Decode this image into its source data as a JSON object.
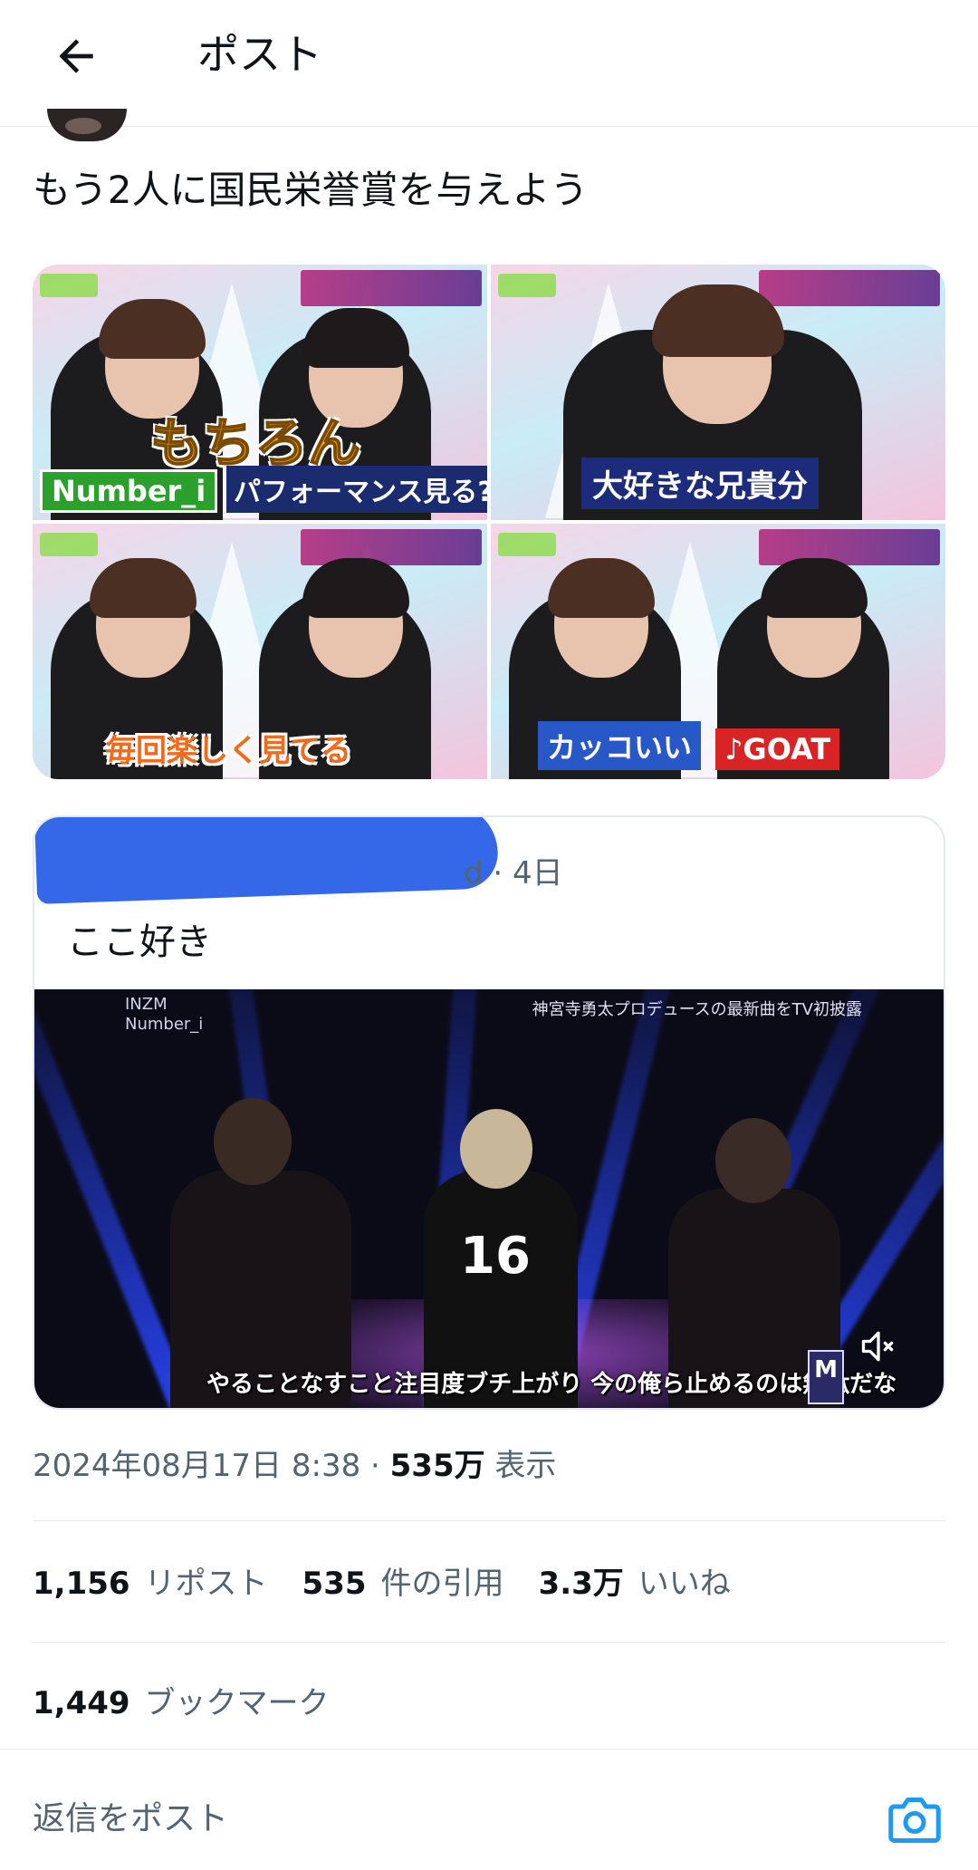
{
  "header": {
    "title": "ポスト",
    "back_icon": "arrow-left-icon"
  },
  "tweet": {
    "text": "もう2人に国民栄誉賞を与えよう",
    "media": [
      {
        "captions": [
          "もちろん",
          "Number_i",
          "パフォーマンス見る?"
        ]
      },
      {
        "captions": [
          "大好きな兄貴分"
        ]
      },
      {
        "captions": [
          "毎回楽しく見てる"
        ]
      },
      {
        "captions": [
          "カッコいい",
          "♪GOAT"
        ]
      }
    ]
  },
  "quote": {
    "time": "d · 4日",
    "text": "ここ好き",
    "video": {
      "label_top_left": "INZM\nNumber_i",
      "label_top_right": "神宮寺勇太プロデュースの最新曲をTV初披露",
      "subtitle": "やることなすこと注目度ブチ上がり 今の俺ら止めるのは無駄だな",
      "badge": "M",
      "shirt_number": "16"
    }
  },
  "meta": {
    "date": "2024年08月17日 8:38 · ",
    "views": "535万",
    "views_label": " 表示"
  },
  "stats": {
    "reposts": "1,156",
    "reposts_label": "リポスト",
    "quotes": "535",
    "quotes_label": "件の引用",
    "likes": "3.3万",
    "likes_label": "いいね",
    "bookmarks": "1,449",
    "bookmarks_label": "ブックマーク"
  },
  "reply": {
    "placeholder": "返信をポスト",
    "camera_icon": "camera-icon"
  },
  "colors": {
    "text": "#0f1419",
    "secondary": "#536471",
    "accent": "#1d9bf0",
    "divider": "#e6e9ec"
  }
}
